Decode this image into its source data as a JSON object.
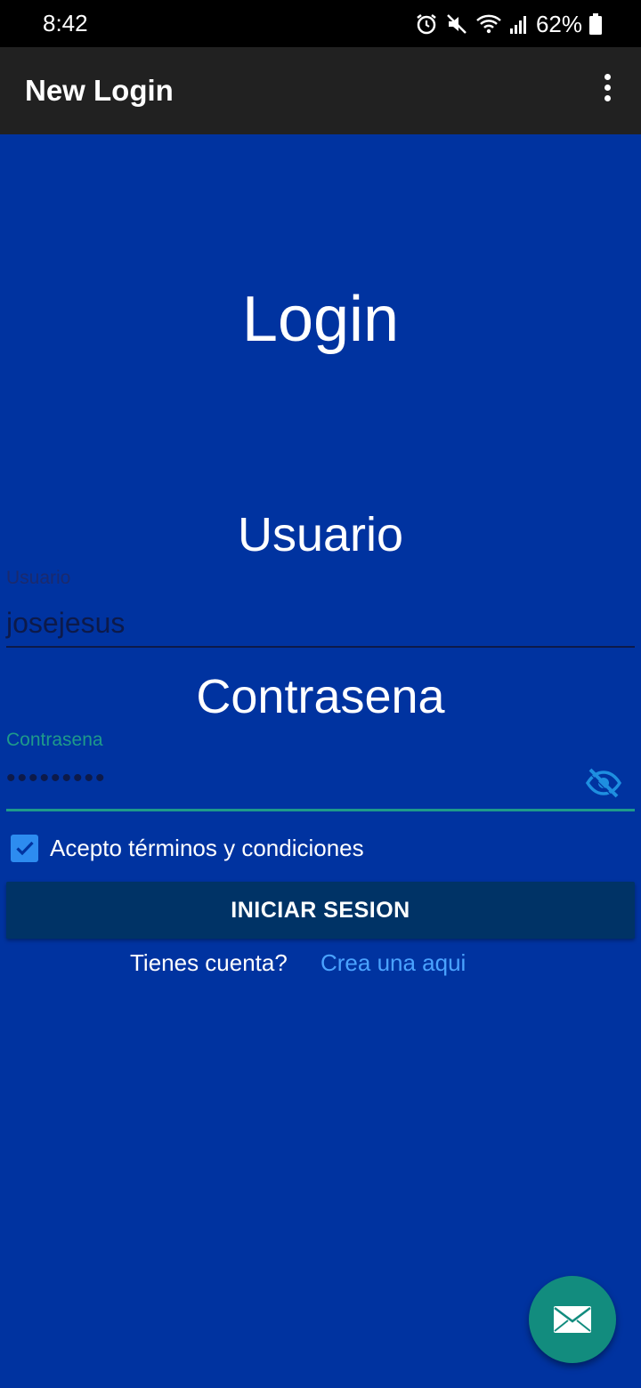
{
  "status_bar": {
    "time": "8:42",
    "battery": "62%",
    "icons": [
      "alarm-icon",
      "mute-icon",
      "wifi-icon",
      "signal-icon",
      "battery-icon"
    ]
  },
  "app_bar": {
    "title": "New Login",
    "menu_icon": "more-vert-icon"
  },
  "main": {
    "heading": "Login",
    "user_section_label": "Usuario",
    "password_section_label": "Contrasena"
  },
  "form": {
    "username": {
      "floating_label": "Usuario",
      "value": "josejesus"
    },
    "password": {
      "floating_label": "Contrasena",
      "masked_value": "•••••••••",
      "toggle_icon": "eye-off-icon"
    },
    "terms": {
      "checked": true,
      "label": "Acepto términos y condiciones"
    },
    "submit_label": "INICIAR SESION"
  },
  "signup": {
    "question": "Tienes cuenta?",
    "link": "Crea una aqui"
  },
  "fab": {
    "icon": "mail-icon"
  },
  "colors": {
    "background": "#0033a0",
    "app_bar": "#212121",
    "button": "#003366",
    "accent": "#1e9a8a",
    "link": "#4aa3ff",
    "checkbox": "#2d8cf0",
    "fab": "#128c7e"
  }
}
